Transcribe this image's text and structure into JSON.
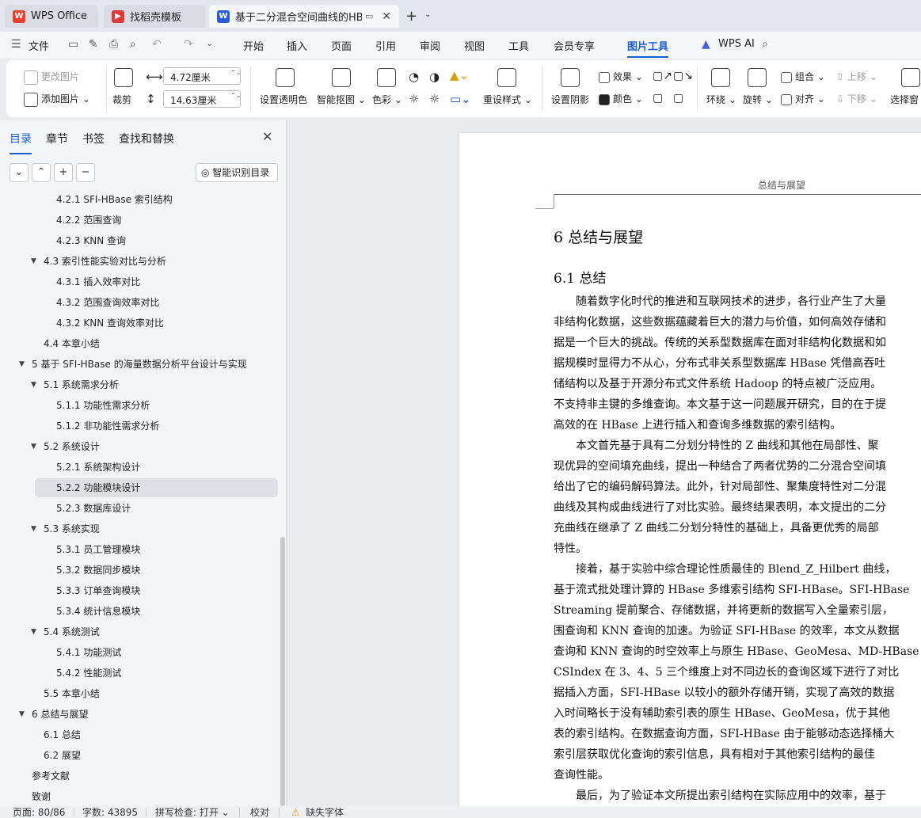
{
  "tabs": [
    {
      "label": "WPS Office",
      "logo": "W",
      "logo_color": "#e8402d"
    },
    {
      "label": "找稻壳模板",
      "logo": "▶",
      "logo_color": "#e03b3b"
    },
    {
      "label": "基于二分混合空间曲线的HBase",
      "logo": "W",
      "logo_color": "#2a5bd7"
    }
  ],
  "menu": {
    "file": "文件",
    "items": [
      "开始",
      "插入",
      "页面",
      "引用",
      "审阅",
      "视图",
      "工具",
      "会员专享",
      "图片工具"
    ],
    "active": "图片工具",
    "ai": "WPS AI"
  },
  "ribbon": {
    "change_pic": "更改图片",
    "add_pic": "添加图片",
    "crop": "裁剪",
    "width": "4.72厘米",
    "height": "14.63厘米",
    "transparent": "设置透明色",
    "smart_cutout": "智能抠图",
    "color": "色彩",
    "reset_style": "重设样式",
    "shadow": "设置阴影",
    "effect": "效果",
    "color2": "颜色",
    "group": "组合",
    "move_up": "上移",
    "wrap": "环绕",
    "rotate": "旋转",
    "align": "对齐",
    "move_down": "下移",
    "select_pane": "选择窗"
  },
  "nav": {
    "tabs": [
      "目录",
      "章节",
      "书签",
      "查找和替换"
    ],
    "smart_btn": "智能识别目录",
    "items": [
      {
        "text": "4.2.1 SFI-HBase 索引结构",
        "level": 3
      },
      {
        "text": "4.2.2  范围查询",
        "level": 3
      },
      {
        "text": "4.2.3 KNN 查询",
        "level": 3
      },
      {
        "text": "4.3 索引性能实验对比与分析",
        "level": 2,
        "caret": true
      },
      {
        "text": "4.3.1  插入效率对比",
        "level": 3
      },
      {
        "text": "4.3.2  范围查询效率对比",
        "level": 3
      },
      {
        "text": "4.3.2 KNN 查询效率对比",
        "level": 3
      },
      {
        "text": "4.4  本章小结",
        "level": 2
      },
      {
        "text": "5  基于 SFI-HBase 的海量数据分析平台设计与实现",
        "level": 1,
        "caret": true
      },
      {
        "text": "5.1  系统需求分析",
        "level": 2,
        "caret": true
      },
      {
        "text": "5.1.1  功能性需求分析",
        "level": 3
      },
      {
        "text": "5.1.2  非功能性需求分析",
        "level": 3
      },
      {
        "text": "5.2  系统设计",
        "level": 2,
        "caret": true
      },
      {
        "text": "5.2.1  系统架构设计",
        "level": 3
      },
      {
        "text": "5.2.2  功能模块设计",
        "level": 3,
        "selected": true
      },
      {
        "text": "5.2.3  数据库设计",
        "level": 3
      },
      {
        "text": "5.3 系统实现",
        "level": 2,
        "caret": true
      },
      {
        "text": "5.3.1  员工管理模块",
        "level": 3
      },
      {
        "text": "5.3.2  数据同步模块",
        "level": 3
      },
      {
        "text": "5.3.3  订单查询模块",
        "level": 3
      },
      {
        "text": "5.3.4  统计信息模块",
        "level": 3
      },
      {
        "text": "5.4  系统测试",
        "level": 2,
        "caret": true
      },
      {
        "text": "5.4.1  功能测试",
        "level": 3
      },
      {
        "text": "5.4.2  性能测试",
        "level": 3
      },
      {
        "text": "5.5  本章小结",
        "level": 2
      },
      {
        "text": "6  总结与展望",
        "level": 1,
        "caret": true
      },
      {
        "text": "6.1  总结",
        "level": 2
      },
      {
        "text": "6.2  展望",
        "level": 2
      },
      {
        "text": "参考文献",
        "level": 1
      },
      {
        "text": "致谢",
        "level": 1
      }
    ]
  },
  "doc": {
    "header": "总结与展望",
    "chapter_title": "6  总结与展望",
    "section_title": "6.1  总结",
    "paragraphs": [
      [
        "　　随着数字化时代的推进和互联网技术的进步，各行业产生了大量",
        "非结构化数据，这些数据蕴藏着巨大的潜力与价值，如何高效存储和",
        "据是一个巨大的挑战。传统的关系型数据库在面对非结构化数据和如",
        "据规模时显得力不从心，分布式非关系型数据库 HBase 凭借高吞吐",
        "储结构以及基于开源分布式文件系统 Hadoop 的特点被广泛应用。",
        "不支持非主键的多维查询。本文基于这一问题展开研究，目的在于提",
        "高效的在 HBase 上进行插入和查询多维数据的索引结构。"
      ],
      [
        "　　本文首先基于具有二分划分特性的 Z 曲线和其他在局部性、聚",
        "现优异的空间填充曲线，提出一种结合了两者优势的二分混合空间填",
        "给出了它的编码解码算法。此外，针对局部性、聚集度特性对二分混",
        "曲线及其构成曲线进行了对比实验。最终结果表明，本文提出的二分",
        "充曲线在继承了 Z 曲线二分划分特性的基础上，具备更优秀的局部",
        "特性。"
      ],
      [
        "　　接着，基于实验中综合理论性质最佳的 Blend_Z_Hilbert 曲线，",
        "基于流式批处理计算的 HBase 多维索引结构 SFI-HBase。SFI-HBase",
        "Streaming 提前聚合、存储数据，并将更新的数据写入全量索引层，",
        "围查询和 KNN 查询的加速。为验证 SFI-HBase 的效率，本文从数据",
        "查询和 KNN 查询的时空效率上与原生 HBase、GeoMesa、MD-HBase",
        "CSIndex 在 3、4、5 三个维度上对不同边长的查询区域下进行了对比",
        "据插入方面，SFI-HBase 以较小的额外存储开销，实现了高效的数据",
        "入时间略长于没有辅助索引表的原生 HBase、GeoMesa，优于其他",
        "表的索引结构。在数据查询方面，SFI-HBase 由于能够动态选择桶大",
        "索引层获取优化查询的索引信息，具有相对于其他索引结构的最佳",
        "查询性能。"
      ],
      [
        "　　最后，为了验证本文所提出索引结构在实际应用中的效率，基于"
      ]
    ]
  },
  "status": {
    "page": "页面: 80/86",
    "words": "字数: 43895",
    "spell": "拼写检查: 打开",
    "proof": "校对",
    "missing_font": "缺失字体"
  }
}
